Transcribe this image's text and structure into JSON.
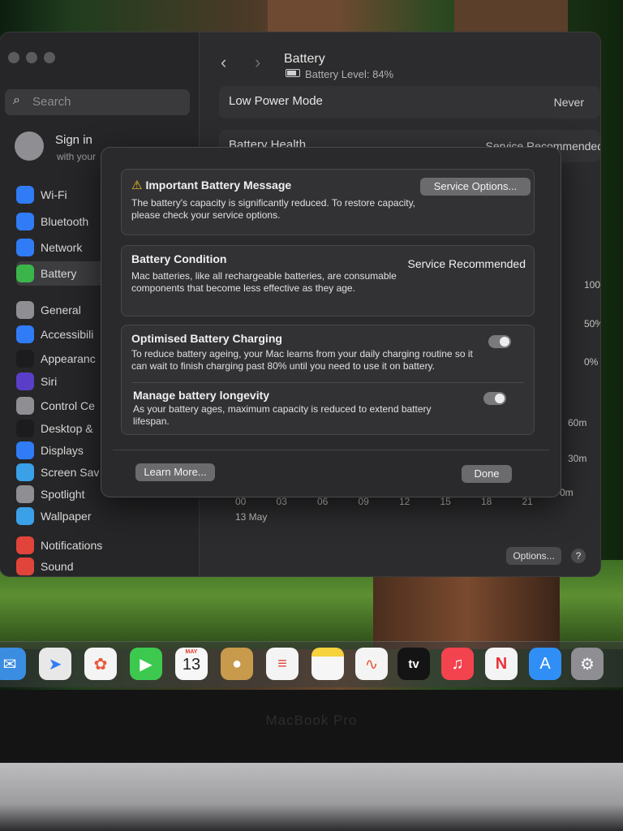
{
  "sidebar": {
    "search_placeholder": "Search",
    "signin_title": "Sign in",
    "signin_subtitle": "with your",
    "items": [
      {
        "label": "Wi-Fi",
        "icon": "wifi-icon",
        "color": "#2f7cf6"
      },
      {
        "label": "Bluetooth",
        "icon": "bluetooth-icon",
        "color": "#2f7cf6"
      },
      {
        "label": "Network",
        "icon": "globe-icon",
        "color": "#2f7cf6"
      },
      {
        "label": "Battery",
        "icon": "battery-icon",
        "color": "#3bb54a"
      },
      {
        "label": "General",
        "icon": "gear-icon",
        "color": "#8e8e93"
      },
      {
        "label": "Accessibili",
        "icon": "accessibility-icon",
        "color": "#2f7cf6"
      },
      {
        "label": "Appearanc",
        "icon": "appearance-icon",
        "color": "#1c1c1e"
      },
      {
        "label": "Siri",
        "icon": "siri-icon",
        "color": "#5a3ec8"
      },
      {
        "label": "Control Ce",
        "icon": "control-center-icon",
        "color": "#8e8e93"
      },
      {
        "label": "Desktop &",
        "icon": "desktop-icon",
        "color": "#1c1c1e"
      },
      {
        "label": "Displays",
        "icon": "displays-icon",
        "color": "#2f7cf6"
      },
      {
        "label": "Screen Sav",
        "icon": "screen-saver-icon",
        "color": "#3aa0e8"
      },
      {
        "label": "Spotlight",
        "icon": "spotlight-icon",
        "color": "#8e8e93"
      },
      {
        "label": "Wallpaper",
        "icon": "wallpaper-icon",
        "color": "#3aa0e8"
      },
      {
        "label": "Notifications",
        "icon": "notifications-icon",
        "color": "#e0443a"
      },
      {
        "label": "Sound",
        "icon": "sound-icon",
        "color": "#e0443a"
      }
    ]
  },
  "header": {
    "title": "Battery",
    "subtitle": "Battery Level: 84%"
  },
  "settings": {
    "low_power_label": "Low Power Mode",
    "low_power_value": "Never",
    "health_label": "Battery Health",
    "health_value": "Service Recommended",
    "partial_right": "s"
  },
  "chart": {
    "y_right": [
      "100%",
      "50%",
      "0%"
    ],
    "y_right2": [
      "60m",
      "30m",
      "0m"
    ],
    "x_ticks": [
      "00",
      "03",
      "06",
      "09",
      "12",
      "15",
      "18",
      "21"
    ],
    "date": "13 May",
    "partial_1": "1"
  },
  "footer": {
    "options_label": "Options...",
    "help_label": "?"
  },
  "dialog": {
    "message_title": "Important Battery Message",
    "message_body": "The battery's capacity is significantly reduced. To restore capacity, please check your service options.",
    "service_options_label": "Service Options...",
    "condition_title": "Battery Condition",
    "condition_value": "Service Recommended",
    "condition_body": "Mac batteries, like all rechargeable batteries, are consumable components that become less effective as they age.",
    "optimised_title": "Optimised Battery Charging",
    "optimised_body": "To reduce battery ageing, your Mac learns from your daily charging routine so it can wait to finish charging past 80% until you need to use it on battery.",
    "longevity_title": "Manage battery longevity",
    "longevity_body": "As your battery ages, maximum capacity is reduced to extend battery lifespan.",
    "learn_more_label": "Learn More...",
    "done_label": "Done"
  },
  "dock": {
    "calendar_month": "MAY",
    "calendar_day": "13",
    "tv_label": "tv"
  },
  "laptop": {
    "label": "MacBook Pro"
  }
}
